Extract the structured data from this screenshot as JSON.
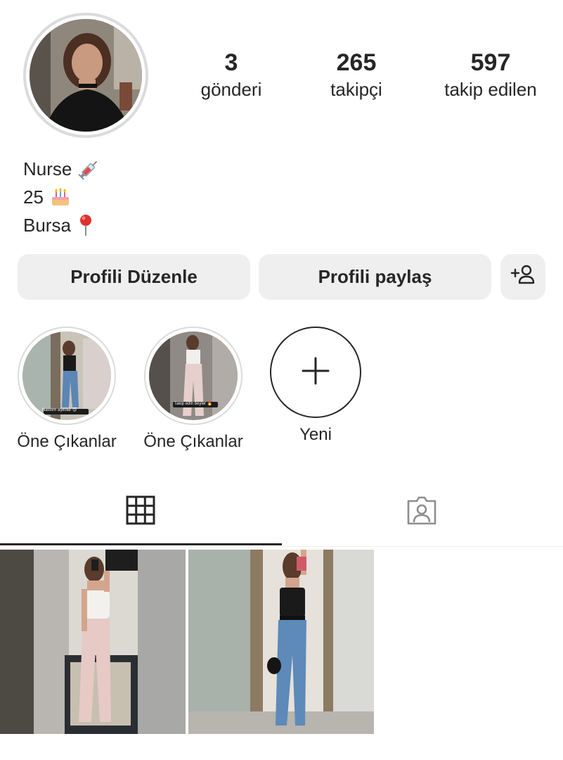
{
  "profile": {
    "stats": [
      {
        "value": "3",
        "label": "gönderi"
      },
      {
        "value": "265",
        "label": "takipçi"
      },
      {
        "value": "597",
        "label": "takip edilen"
      }
    ],
    "bio": [
      {
        "text": "Nurse",
        "icon": "syringe-icon"
      },
      {
        "text": "25",
        "icon": "birthday-cake-icon"
      },
      {
        "text": "Bursa",
        "icon": "round-pushpin-icon"
      }
    ]
  },
  "actions": {
    "edit_label": "Profili Düzenle",
    "share_label": "Profili paylaş",
    "add_person_icon": "add-person-icon"
  },
  "highlights": [
    {
      "label": "Öne Çıkanlar",
      "caption": "Nasılım aşkolar 😈"
    },
    {
      "label": "Öne Çıkanlar",
      "caption": "Takip edin beyler 🔥"
    },
    {
      "label": "Yeni",
      "icon": "plus-icon"
    }
  ],
  "tabs": [
    {
      "name": "posts-grid",
      "icon": "grid-icon",
      "active": true
    },
    {
      "name": "tagged",
      "icon": "tagged-person-icon",
      "active": false
    }
  ],
  "colors": {
    "text": "#262626",
    "button_bg": "#efefef",
    "ring": "#dbdbdb"
  }
}
